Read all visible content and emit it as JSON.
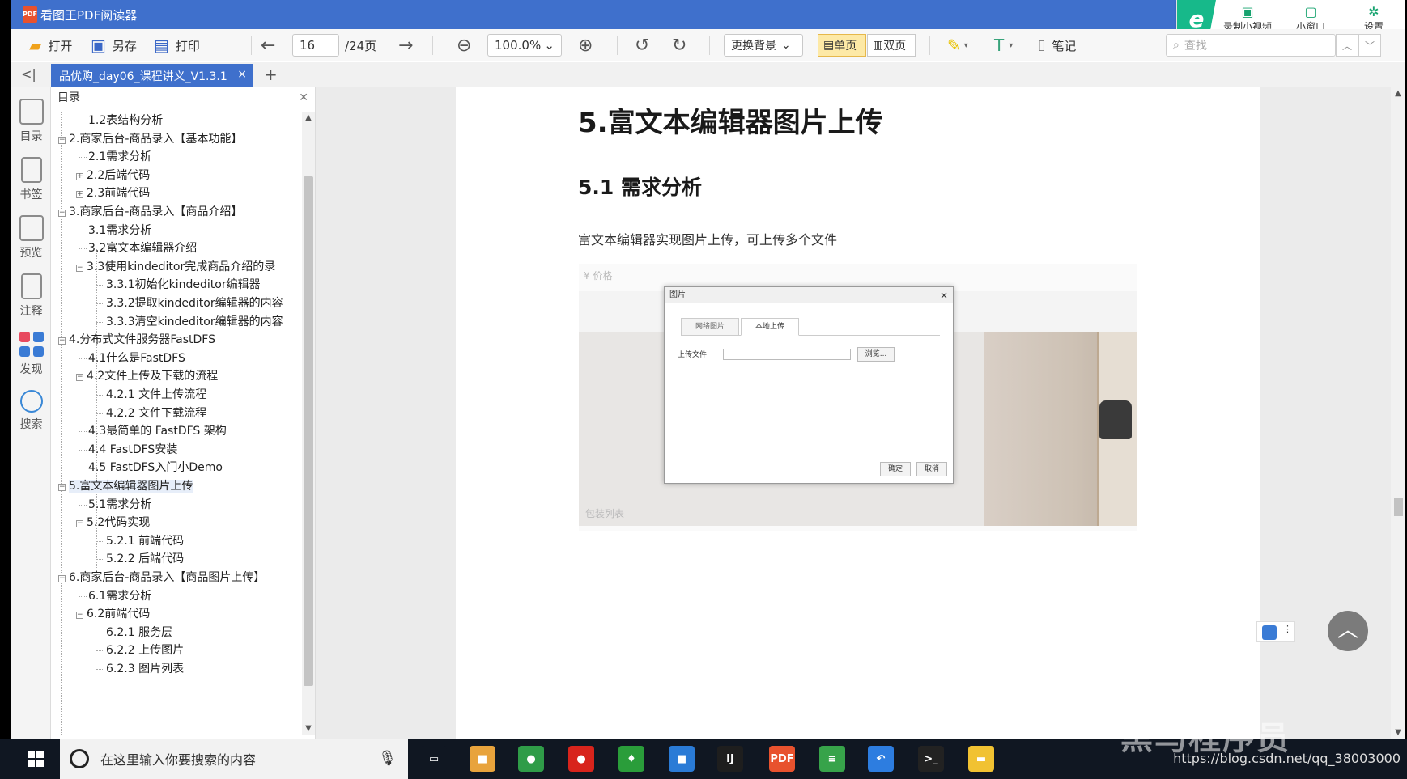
{
  "window": {
    "app_title": "看图王PDF阅读器",
    "app_icon_text": "PDF",
    "right_tools": [
      {
        "label": "录制小视频",
        "icon": "video-icon"
      },
      {
        "label": "小窗口",
        "icon": "mini-window-icon"
      },
      {
        "label": "设置",
        "icon": "gear-icon"
      }
    ]
  },
  "toolbar": {
    "open": "打开",
    "save_as": "另存",
    "print": "打印",
    "current_page": "16",
    "total_pages": "/24页",
    "zoom": "100.0%",
    "background": "更换背景",
    "single_page": "单页",
    "double_page": "双页",
    "notes": "笔记",
    "search_placeholder": "查找"
  },
  "tabs": {
    "active": "品优购_day06_课程讲义_V1.3.1",
    "close": "×",
    "add": "+",
    "collapse": "<|"
  },
  "rail": [
    {
      "label": "目录",
      "icon": "list-icon"
    },
    {
      "label": "书签",
      "icon": "bookmark-icon"
    },
    {
      "label": "预览",
      "icon": "preview-icon"
    },
    {
      "label": "注释",
      "icon": "annotation-icon"
    },
    {
      "label": "发现",
      "icon": "discover-icon"
    },
    {
      "label": "搜索",
      "icon": "search-icon"
    }
  ],
  "outline": {
    "title": "目录",
    "items": [
      {
        "text": "1.2表结构分析",
        "level": 1,
        "toggle": ""
      },
      {
        "text": "2.商家后台-商品录入【基本功能】",
        "level": 0,
        "toggle": "−"
      },
      {
        "text": "2.1需求分析",
        "level": 1,
        "toggle": ""
      },
      {
        "text": "2.2后端代码",
        "level": 1,
        "toggle": "+"
      },
      {
        "text": "2.3前端代码",
        "level": 1,
        "toggle": "+"
      },
      {
        "text": "3.商家后台-商品录入【商品介绍】",
        "level": 0,
        "toggle": "−"
      },
      {
        "text": "3.1需求分析",
        "level": 1,
        "toggle": ""
      },
      {
        "text": "3.2富文本编辑器介绍",
        "level": 1,
        "toggle": ""
      },
      {
        "text": "3.3使用kindeditor完成商品介绍的录",
        "level": 1,
        "toggle": "−"
      },
      {
        "text": "3.3.1初始化kindeditor编辑器",
        "level": 2,
        "toggle": ""
      },
      {
        "text": "3.3.2提取kindeditor编辑器的内容",
        "level": 2,
        "toggle": ""
      },
      {
        "text": "3.3.3清空kindeditor编辑器的内容",
        "level": 2,
        "toggle": ""
      },
      {
        "text": "4.分布式文件服务器FastDFS",
        "level": 0,
        "toggle": "−"
      },
      {
        "text": "4.1什么是FastDFS",
        "level": 1,
        "toggle": ""
      },
      {
        "text": "4.2文件上传及下载的流程",
        "level": 1,
        "toggle": "−"
      },
      {
        "text": "4.2.1 文件上传流程",
        "level": 2,
        "toggle": ""
      },
      {
        "text": "4.2.2 文件下载流程",
        "level": 2,
        "toggle": ""
      },
      {
        "text": "4.3最简单的 FastDFS 架构",
        "level": 1,
        "toggle": ""
      },
      {
        "text": "4.4 FastDFS安装",
        "level": 1,
        "toggle": ""
      },
      {
        "text": "4.5 FastDFS入门小Demo",
        "level": 1,
        "toggle": ""
      },
      {
        "text": "5.富文本编辑器图片上传",
        "level": 0,
        "toggle": "−",
        "selected": true
      },
      {
        "text": "5.1需求分析",
        "level": 1,
        "toggle": ""
      },
      {
        "text": "5.2代码实现",
        "level": 1,
        "toggle": "−"
      },
      {
        "text": "5.2.1 前端代码",
        "level": 2,
        "toggle": ""
      },
      {
        "text": "5.2.2 后端代码",
        "level": 2,
        "toggle": ""
      },
      {
        "text": "6.商家后台-商品录入【商品图片上传】",
        "level": 0,
        "toggle": "−"
      },
      {
        "text": "6.1需求分析",
        "level": 1,
        "toggle": ""
      },
      {
        "text": "6.2前端代码",
        "level": 1,
        "toggle": "−"
      },
      {
        "text": "6.2.1 服务层",
        "level": 2,
        "toggle": ""
      },
      {
        "text": "6.2.2 上传图片",
        "level": 2,
        "toggle": ""
      },
      {
        "text": "6.2.3 图片列表",
        "level": 2,
        "toggle": ""
      }
    ]
  },
  "document": {
    "h1": "5.富文本编辑器图片上传",
    "h2": "5.1 需求分析",
    "paragraph": "富文本编辑器实现图片上传，可上传多个文件",
    "embedded": {
      "top_label": "¥     价格",
      "bottom_label": "包装列表",
      "dialog_title": "图片",
      "tab_network": "网络图片",
      "tab_local": "本地上传",
      "upload_label": "上传文件",
      "browse": "浏览...",
      "ok": "确定",
      "cancel": "取消"
    }
  },
  "taskbar": {
    "search_placeholder": "在这里输入你要搜索的内容",
    "apps": [
      {
        "name": "task-view",
        "glyph": "▭",
        "color": "#101722"
      },
      {
        "name": "app-1",
        "glyph": "■",
        "color": "#e8a33c"
      },
      {
        "name": "chrome",
        "glyph": "●",
        "color": "#2f9c48"
      },
      {
        "name": "app-red",
        "glyph": "●",
        "color": "#d8241c"
      },
      {
        "name": "app-green",
        "glyph": "♦",
        "color": "#2a9d3a"
      },
      {
        "name": "app-blue",
        "glyph": "■",
        "color": "#2a7bd6"
      },
      {
        "name": "intellij",
        "glyph": "IJ",
        "color": "#1e1e1e"
      },
      {
        "name": "pdf-reader",
        "glyph": "PDF",
        "color": "#e8522e"
      },
      {
        "name": "app-notepad",
        "glyph": "≡",
        "color": "#37a34a"
      },
      {
        "name": "app-arrow",
        "glyph": "↶",
        "color": "#2d7de0"
      },
      {
        "name": "terminal",
        "glyph": ">_",
        "color": "#222"
      },
      {
        "name": "explorer",
        "glyph": "▬",
        "color": "#f1c232"
      }
    ],
    "url_overlay": "https://blog.csdn.net/qq_38003000"
  },
  "watermark": "黑马程序员"
}
